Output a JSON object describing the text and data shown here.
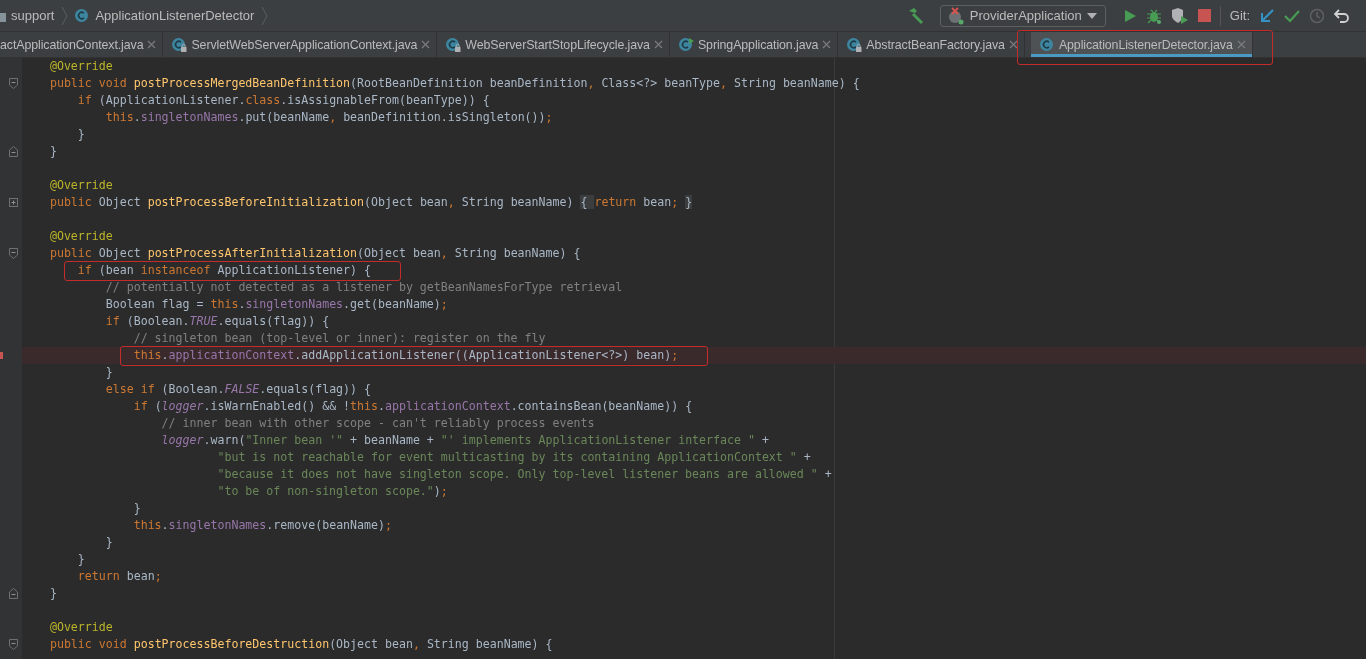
{
  "breadcrumbs": [
    {
      "label": "support"
    },
    {
      "label": "ApplicationListenerDetector"
    }
  ],
  "toolbar": {
    "run_config": "ProviderApplication",
    "vcs_label": "Git:"
  },
  "tabs": [
    {
      "label": "actApplicationContext.java",
      "kind": "plain",
      "selected": false,
      "outlined": false
    },
    {
      "label": "ServletWebServerApplicationContext.java",
      "kind": "locked-class",
      "selected": false,
      "outlined": false
    },
    {
      "label": "WebServerStartStopLifecycle.java",
      "kind": "locked-class",
      "selected": false,
      "outlined": false
    },
    {
      "label": "SpringApplication.java",
      "kind": "runnable-class",
      "selected": false,
      "outlined": false
    },
    {
      "label": "AbstractBeanFactory.java",
      "kind": "locked-class",
      "selected": false,
      "outlined": false
    },
    {
      "label": "ApplicationListenerDetector.java",
      "kind": "class",
      "selected": true,
      "outlined": true
    }
  ],
  "editor": {
    "lines": [
      {
        "kind": "plain",
        "highlighted": false,
        "boxed": false,
        "code": [
          {
            "kind": "annotation",
            "text": "    @Override"
          }
        ]
      },
      {
        "kind": "fold-start",
        "highlighted": false,
        "boxed": false,
        "code": [
          {
            "kind": "keyword",
            "text": "    public void "
          },
          {
            "kind": "method",
            "text": "postProcessMergedBeanDefinition"
          },
          {
            "kind": "plain",
            "text": "(RootBeanDefinition beanDefinition"
          },
          {
            "kind": "keyword",
            "text": ", "
          },
          {
            "kind": "plain",
            "text": "Class<?> beanType"
          },
          {
            "kind": "keyword",
            "text": ", "
          },
          {
            "kind": "plain",
            "text": "String beanName) {"
          }
        ]
      },
      {
        "kind": "plain",
        "highlighted": false,
        "boxed": false,
        "code": [
          {
            "kind": "keyword",
            "text": "        if "
          },
          {
            "kind": "plain",
            "text": "(ApplicationListener."
          },
          {
            "kind": "keyword",
            "text": "class"
          },
          {
            "kind": "plain",
            "text": ".isAssignableFrom(beanType)) {"
          }
        ]
      },
      {
        "kind": "plain",
        "highlighted": false,
        "boxed": false,
        "code": [
          {
            "kind": "keyword",
            "text": "            this"
          },
          {
            "kind": "plain",
            "text": "."
          },
          {
            "kind": "field",
            "text": "singletonNames"
          },
          {
            "kind": "plain",
            "text": ".put(beanName"
          },
          {
            "kind": "keyword",
            "text": ", "
          },
          {
            "kind": "plain",
            "text": "beanDefinition.isSingleton())"
          },
          {
            "kind": "keyword",
            "text": ";"
          }
        ]
      },
      {
        "kind": "plain",
        "highlighted": false,
        "boxed": false,
        "code": [
          {
            "kind": "plain",
            "text": "        }"
          }
        ]
      },
      {
        "kind": "fold-end",
        "highlighted": false,
        "boxed": false,
        "code": [
          {
            "kind": "plain",
            "text": "    }"
          }
        ]
      },
      {
        "kind": "plain",
        "highlighted": false,
        "boxed": false
      },
      {
        "kind": "plain",
        "highlighted": false,
        "boxed": false,
        "code": [
          {
            "kind": "annotation",
            "text": "    @Override"
          }
        ]
      },
      {
        "kind": "folded",
        "highlighted": false,
        "boxed": false,
        "code": [
          {
            "kind": "keyword",
            "text": "    public "
          },
          {
            "kind": "plain",
            "text": "Object "
          },
          {
            "kind": "method",
            "text": "postProcessBeforeInitialization"
          },
          {
            "kind": "plain",
            "text": "(Object bean"
          },
          {
            "kind": "keyword",
            "text": ", "
          },
          {
            "kind": "plain",
            "text": "String beanName) "
          },
          {
            "kind": "fold-brace",
            "text": "{ "
          },
          {
            "kind": "keyword",
            "text": "return "
          },
          {
            "kind": "plain",
            "text": "bean"
          },
          {
            "kind": "keyword",
            "text": "; "
          },
          {
            "kind": "fold-brace",
            "text": "}"
          }
        ]
      },
      {
        "kind": "plain",
        "highlighted": false,
        "boxed": false
      },
      {
        "kind": "plain",
        "highlighted": false,
        "boxed": false,
        "code": [
          {
            "kind": "annotation",
            "text": "    @Override"
          }
        ]
      },
      {
        "kind": "fold-start",
        "highlighted": false,
        "boxed": false,
        "code": [
          {
            "kind": "keyword",
            "text": "    public "
          },
          {
            "kind": "plain",
            "text": "Object "
          },
          {
            "kind": "method",
            "text": "postProcessAfterInitialization"
          },
          {
            "kind": "plain",
            "text": "(Object bean"
          },
          {
            "kind": "keyword",
            "text": ", "
          },
          {
            "kind": "plain",
            "text": "String beanName) {"
          }
        ]
      },
      {
        "kind": "plain",
        "highlighted": false,
        "boxed": true,
        "code": [
          {
            "kind": "keyword",
            "text": "        if "
          },
          {
            "kind": "plain",
            "text": "(bean "
          },
          {
            "kind": "keyword",
            "text": "instanceof "
          },
          {
            "kind": "plain",
            "text": "ApplicationListener) {"
          }
        ]
      },
      {
        "kind": "plain",
        "highlighted": false,
        "boxed": false,
        "code": [
          {
            "kind": "comment",
            "text": "            // potentially not detected as a listener by getBeanNamesForType retrieval"
          }
        ]
      },
      {
        "kind": "plain",
        "highlighted": false,
        "boxed": false,
        "code": [
          {
            "kind": "plain",
            "text": "            Boolean flag = "
          },
          {
            "kind": "keyword",
            "text": "this"
          },
          {
            "kind": "plain",
            "text": "."
          },
          {
            "kind": "field",
            "text": "singletonNames"
          },
          {
            "kind": "plain",
            "text": ".get(beanName)"
          },
          {
            "kind": "keyword",
            "text": ";"
          }
        ]
      },
      {
        "kind": "plain",
        "highlighted": false,
        "boxed": false,
        "code": [
          {
            "kind": "keyword",
            "text": "            if "
          },
          {
            "kind": "plain",
            "text": "(Boolean."
          },
          {
            "kind": "static",
            "text": "TRUE"
          },
          {
            "kind": "plain",
            "text": ".equals(flag)) {"
          }
        ]
      },
      {
        "kind": "plain",
        "highlighted": false,
        "boxed": false,
        "code": [
          {
            "kind": "comment",
            "text": "                // singleton bean (top-level or inner): register on the fly"
          }
        ]
      },
      {
        "kind": "plain",
        "highlighted": true,
        "boxed": true,
        "code": [
          {
            "kind": "keyword",
            "text": "                this"
          },
          {
            "kind": "plain",
            "text": "."
          },
          {
            "kind": "field",
            "text": "applicationContext"
          },
          {
            "kind": "plain",
            "text": ".addApplicationListener((ApplicationListener<?>) bean)"
          },
          {
            "kind": "keyword",
            "text": ";"
          }
        ]
      },
      {
        "kind": "plain",
        "highlighted": false,
        "boxed": false,
        "code": [
          {
            "kind": "plain",
            "text": "            }"
          }
        ]
      },
      {
        "kind": "plain",
        "highlighted": false,
        "boxed": false,
        "code": [
          {
            "kind": "keyword",
            "text": "            else if "
          },
          {
            "kind": "plain",
            "text": "(Boolean."
          },
          {
            "kind": "static",
            "text": "FALSE"
          },
          {
            "kind": "plain",
            "text": ".equals(flag)) {"
          }
        ]
      },
      {
        "kind": "plain",
        "highlighted": false,
        "boxed": false,
        "code": [
          {
            "kind": "keyword",
            "text": "                if "
          },
          {
            "kind": "plain",
            "text": "("
          },
          {
            "kind": "static",
            "text": "logger"
          },
          {
            "kind": "plain",
            "text": ".isWarnEnabled() && !"
          },
          {
            "kind": "keyword",
            "text": "this"
          },
          {
            "kind": "plain",
            "text": "."
          },
          {
            "kind": "field",
            "text": "applicationContext"
          },
          {
            "kind": "plain",
            "text": ".containsBean(beanName)) {"
          }
        ]
      },
      {
        "kind": "plain",
        "highlighted": false,
        "boxed": false,
        "code": [
          {
            "kind": "comment",
            "text": "                    // inner bean with other scope - can't reliably process events"
          }
        ]
      },
      {
        "kind": "plain",
        "highlighted": false,
        "boxed": false,
        "code": [
          {
            "kind": "static",
            "text": "                    logger"
          },
          {
            "kind": "plain",
            "text": ".warn("
          },
          {
            "kind": "string",
            "text": "\"Inner bean '\""
          },
          {
            "kind": "plain",
            "text": " + beanName + "
          },
          {
            "kind": "string",
            "text": "\"' implements ApplicationListener interface \""
          },
          {
            "kind": "plain",
            "text": " +"
          }
        ]
      },
      {
        "kind": "plain",
        "highlighted": false,
        "boxed": false,
        "code": [
          {
            "kind": "string",
            "text": "                            \"but is not reachable for event multicasting by its containing ApplicationContext \""
          },
          {
            "kind": "plain",
            "text": " +"
          }
        ]
      },
      {
        "kind": "plain",
        "highlighted": false,
        "boxed": false,
        "code": [
          {
            "kind": "string",
            "text": "                            \"because it does not have singleton scope. Only top-level listener beans are allowed \""
          },
          {
            "kind": "plain",
            "text": " +"
          }
        ]
      },
      {
        "kind": "plain",
        "highlighted": false,
        "boxed": false,
        "code": [
          {
            "kind": "string",
            "text": "                            \"to be of non-singleton scope.\""
          },
          {
            "kind": "plain",
            "text": ")"
          },
          {
            "kind": "keyword",
            "text": ";"
          }
        ]
      },
      {
        "kind": "plain",
        "highlighted": false,
        "boxed": false,
        "code": [
          {
            "kind": "plain",
            "text": "                }"
          }
        ]
      },
      {
        "kind": "plain",
        "highlighted": false,
        "boxed": false,
        "code": [
          {
            "kind": "keyword",
            "text": "                this"
          },
          {
            "kind": "plain",
            "text": "."
          },
          {
            "kind": "field",
            "text": "singletonNames"
          },
          {
            "kind": "plain",
            "text": ".remove(beanName)"
          },
          {
            "kind": "keyword",
            "text": ";"
          }
        ]
      },
      {
        "kind": "plain",
        "highlighted": false,
        "boxed": false,
        "code": [
          {
            "kind": "plain",
            "text": "            }"
          }
        ]
      },
      {
        "kind": "plain",
        "highlighted": false,
        "boxed": false,
        "code": [
          {
            "kind": "plain",
            "text": "        }"
          }
        ]
      },
      {
        "kind": "plain",
        "highlighted": false,
        "boxed": false,
        "code": [
          {
            "kind": "keyword",
            "text": "        return "
          },
          {
            "kind": "plain",
            "text": "bean"
          },
          {
            "kind": "keyword",
            "text": ";"
          }
        ]
      },
      {
        "kind": "fold-end",
        "highlighted": false,
        "boxed": false,
        "code": [
          {
            "kind": "plain",
            "text": "    }"
          }
        ]
      },
      {
        "kind": "plain",
        "highlighted": false,
        "boxed": false
      },
      {
        "kind": "plain",
        "highlighted": false,
        "boxed": false,
        "code": [
          {
            "kind": "annotation",
            "text": "    @Override"
          }
        ]
      },
      {
        "kind": "fold-start",
        "highlighted": false,
        "boxed": false,
        "code": [
          {
            "kind": "keyword",
            "text": "    public void "
          },
          {
            "kind": "method",
            "text": "postProcessBeforeDestruction"
          },
          {
            "kind": "plain",
            "text": "(Object bean"
          },
          {
            "kind": "keyword",
            "text": ", "
          },
          {
            "kind": "plain",
            "text": "String beanName) {"
          }
        ]
      }
    ]
  }
}
